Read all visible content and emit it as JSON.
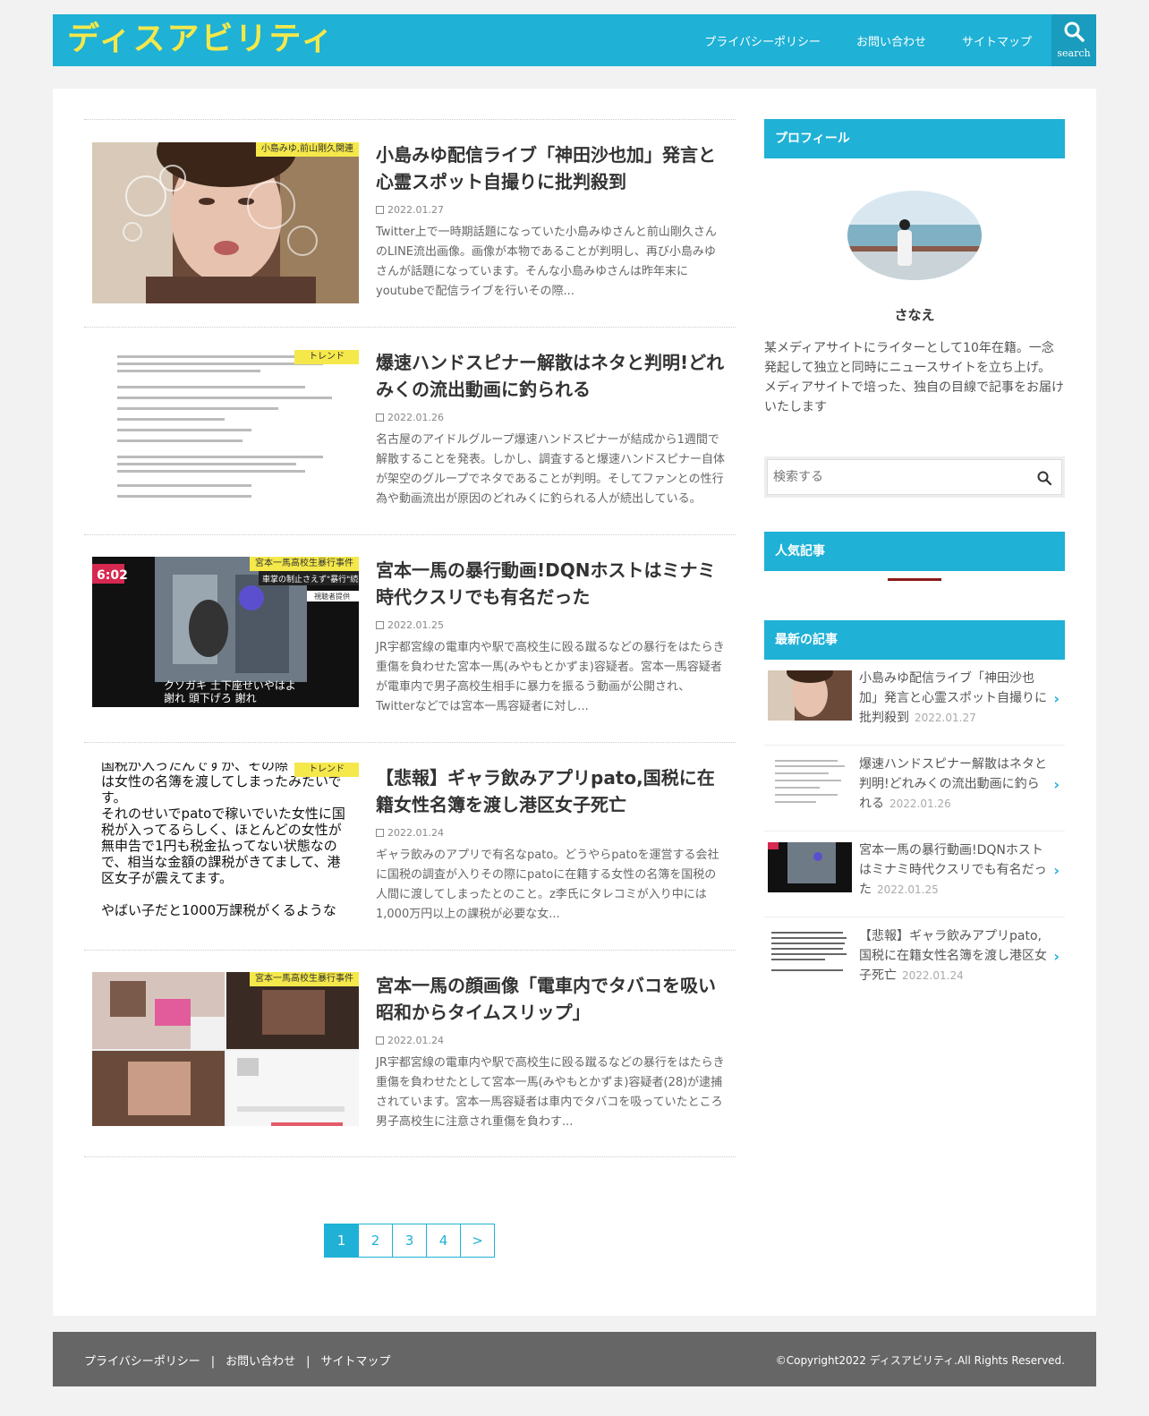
{
  "site": {
    "title": "ディスアビリティ"
  },
  "nav": [
    {
      "label": "プライバシーポリシー"
    },
    {
      "label": "お問い合わせ"
    },
    {
      "label": "サイトマップ"
    }
  ],
  "search_button": {
    "label": "search"
  },
  "articles": [
    {
      "category": "小島みゆ,前山剛久関連",
      "title": "小島みゆ配信ライブ「神田沙也加」発言と心霊スポット自撮りに批判殺到",
      "date": "2022.01.27",
      "excerpt": "Twitter上で一時期話題になっていた小島みゆさんと前山剛久さんのLINE流出画像。画像が本物であることが判明し、再び小島みゆさんが話題になっています。そんな小島みゆさんは昨年末にyoutubeで配信ライブを行いその際..."
    },
    {
      "category": "トレンド",
      "title": "爆速ハンドスピナー解散はネタと判明!どれみくの流出動画に釣られる",
      "date": "2022.01.26",
      "excerpt": "名古屋のアイドルグループ爆速ハンドスピナーが結成から1週間で解散することを発表。しかし、調査すると爆速ハンドスピナー自体が架空のグループでネタであることが判明。そしてファンとの性行為や動画流出が原因のどれみくに釣られる人が続出している。"
    },
    {
      "category": "宮本一馬高校生暴行事件",
      "title": "宮本一馬の暴行動画!DQNホストはミナミ時代クスリでも有名だった",
      "date": "2022.01.25",
      "excerpt": "JR宇都宮線の電車内や駅で高校生に殴る蹴るなどの暴行をはたらき重傷を負わせた宮本一馬(みやもとかずま)容疑者。宮本一馬容疑者が電車内で男子高校生相手に暴力を振るう動画が公開され、Twitterなどでは宮本一馬容疑者に対し..."
    },
    {
      "category": "トレンド",
      "title": "【悲報】ギャラ飲みアプリpato,国税に在籍女性名簿を渡し港区女子死亡",
      "date": "2022.01.24",
      "excerpt": "ギャラ飲みのアプリで有名なpato。どうやらpatoを運営する会社に国税の調査が入りその際にpatoに在籍する女性の名簿を国税の人間に渡してしまったとのこと。z李氏にタレコミが入り中には1,000万円以上の課税が必要な女..."
    },
    {
      "category": "宮本一馬高校生暴行事件",
      "title": "宮本一馬の顔画像「電車内でタバコを吸い昭和からタイムスリップ」",
      "date": "2022.01.24",
      "excerpt": "JR宇都宮線の電車内や駅で高校生に殴る蹴るなどの暴行をはたらき重傷を負わせたとして宮本一馬(みやもとかずま)容疑者(28)が逮捕されています。宮本一馬容疑者は車内でタバコを吸っていたところ男子高校生に注意され重傷を負わす..."
    }
  ],
  "thumb_text": {
    "a3_tag": "6:02",
    "a3_banner": "車掌の制止さえず\"暴行\"続ける",
    "a3_sub": "視聴者提供",
    "a3_cap1": "クソガキ 土下座せいやはよ",
    "a3_cap2": "謝れ 頭下げろ 謝れ",
    "a4_lines": [
      "国税が入ったんですが、その際",
      "は女性の名簿を渡してしまったみたいで",
      "す。",
      "それのせいでpatoで稼いでいた女性に国",
      "税が入ってるらしく、ほとんどの女性が",
      "無申告で1円も税金払ってない状態なの",
      "で、相当な金額の課税がきてまして、港",
      "区女子が震えてます。",
      "",
      "やばい子だと1000万課税がくるような"
    ]
  },
  "pagination": [
    "1",
    "2",
    "3",
    "4",
    ">"
  ],
  "sidebar": {
    "profile_heading": "プロフィール",
    "profile_name": "さなえ",
    "profile_desc": "某メディアサイトにライターとして10年在籍。一念発起して独立と同時にニュースサイトを立ち上げ。\nメディアサイトで培った、独自の目線で記事をお届けいたします",
    "search_placeholder": "検索する",
    "popular_heading": "人気記事",
    "recent_heading": "最新の記事",
    "recent": [
      {
        "title": "小島みゆ配信ライブ「神田沙也加」発言と心霊スポット自撮りに批判殺到",
        "date": "2022.01.27"
      },
      {
        "title": "爆速ハンドスピナー解散はネタと判明!どれみくの流出動画に釣られる",
        "date": "2022.01.26"
      },
      {
        "title": "宮本一馬の暴行動画!DQNホストはミナミ時代クスリでも有名だった",
        "date": "2022.01.25"
      },
      {
        "title": "【悲報】ギャラ飲みアプリpato,国税に在籍女性名簿を渡し港区女子死亡",
        "date": "2022.01.24"
      }
    ]
  },
  "footer": {
    "links": [
      "プライバシーポリシー",
      "お問い合わせ",
      "サイトマップ"
    ],
    "copyright": "©Copyright2022 ディスアビリティ.All Rights Reserved."
  },
  "colors": {
    "accent": "#1fb1d6",
    "logo": "#f5e84a",
    "category": "#f5e84a",
    "footer": "#666666"
  }
}
